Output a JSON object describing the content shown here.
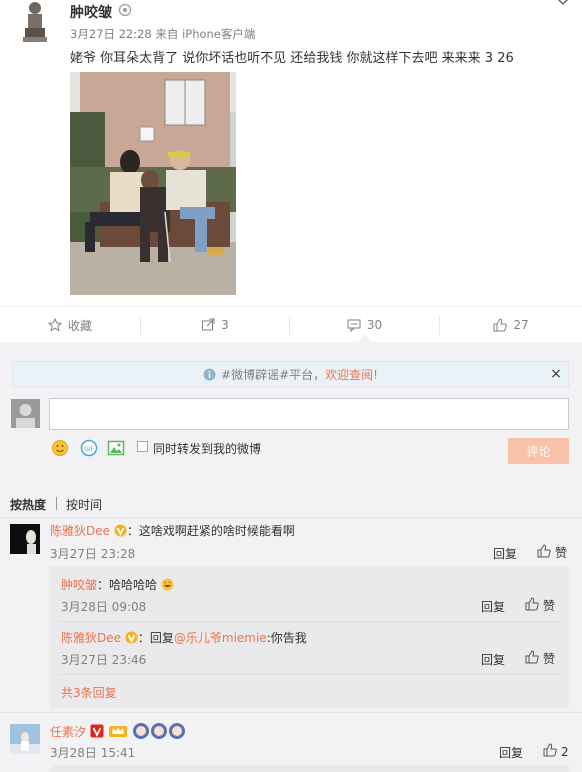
{
  "post": {
    "username": "肿咬皱",
    "date": "3月27日 22:28",
    "source_prefix": "来自",
    "source": "iPhone客户端",
    "text": "姥爷 你耳朵太背了 说你坏话也听不见 还给我钱 你就这样下去吧  来来来 3 26"
  },
  "actions": {
    "favorite": "收藏",
    "repost_count": "3",
    "comment_count": "30",
    "like_count": "27"
  },
  "notice": {
    "prefix": "#微博辟谣#平台，",
    "highlight": "欢迎查阅!",
    "close": "×"
  },
  "composer": {
    "input_value": "",
    "repost_label": "同时转发到我的微博",
    "submit_label": "评论"
  },
  "sort": {
    "hot": "按热度",
    "time": "按时间"
  },
  "comments": [
    {
      "name": "陈雅狄Dee",
      "sep": "：",
      "text": "这啥戏啊赶紧的啥时候能看啊",
      "time": "3月27日 23:28",
      "reply": "回复",
      "like": "赞",
      "replies": [
        {
          "name": "肿咬皱",
          "sep": "：",
          "text": "哈哈哈哈",
          "time": "3月28日 09:08",
          "reply": "回复",
          "like": "赞"
        },
        {
          "name": "陈雅狄Dee",
          "sep": "：",
          "reply_prefix": "回复",
          "mention": "@乐儿爷miemie",
          "text": ":你告我",
          "time": "3月27日 23:46",
          "reply": "回复",
          "like": "赞"
        }
      ],
      "more": "共3条回复"
    },
    {
      "name": "任素汐",
      "time": "3月28日 15:41",
      "reply": "回复",
      "like_count": "2"
    }
  ],
  "colors": {
    "accent": "#eb7350",
    "comment_bg": "#f2f2f5",
    "submit_disabled": "#f7c2a8"
  },
  "icons": [
    "user-badge-icon",
    "caret-down-icon",
    "star-icon",
    "repost-icon",
    "comment-icon",
    "thumbs-up-icon",
    "info-icon",
    "emoji-icon",
    "gif-icon",
    "image-icon",
    "vip-v-icon"
  ]
}
